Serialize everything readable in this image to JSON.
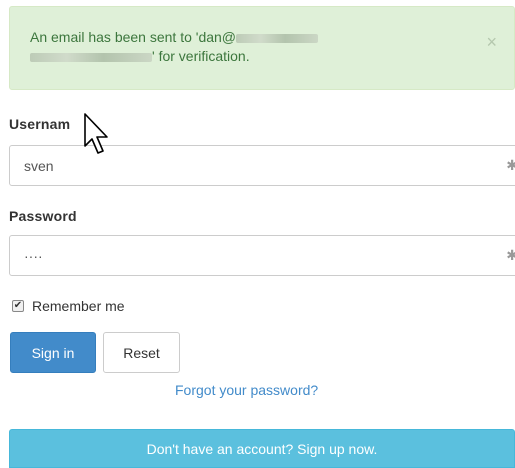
{
  "alert": {
    "line1_prefix": "An email has been sent to 'dan@",
    "line2_suffix": "' for verification.",
    "close_glyph": "×"
  },
  "form": {
    "username_label": "Usernam",
    "username_value": "sven",
    "password_label": "Password",
    "password_value": "····",
    "input_icon_glyph": "✱",
    "remember_label": "Remember me",
    "remember_checked": true,
    "checkbox_glyph": "✔",
    "signin_label": "Sign in",
    "reset_label": "Reset",
    "forgot_label": "Forgot your password?",
    "signup_label": "Don't have an account? Sign up now."
  },
  "colors": {
    "alert_bg": "#dff0d8",
    "alert_text": "#3c763d",
    "primary": "#428bca",
    "info": "#5bc0de"
  }
}
